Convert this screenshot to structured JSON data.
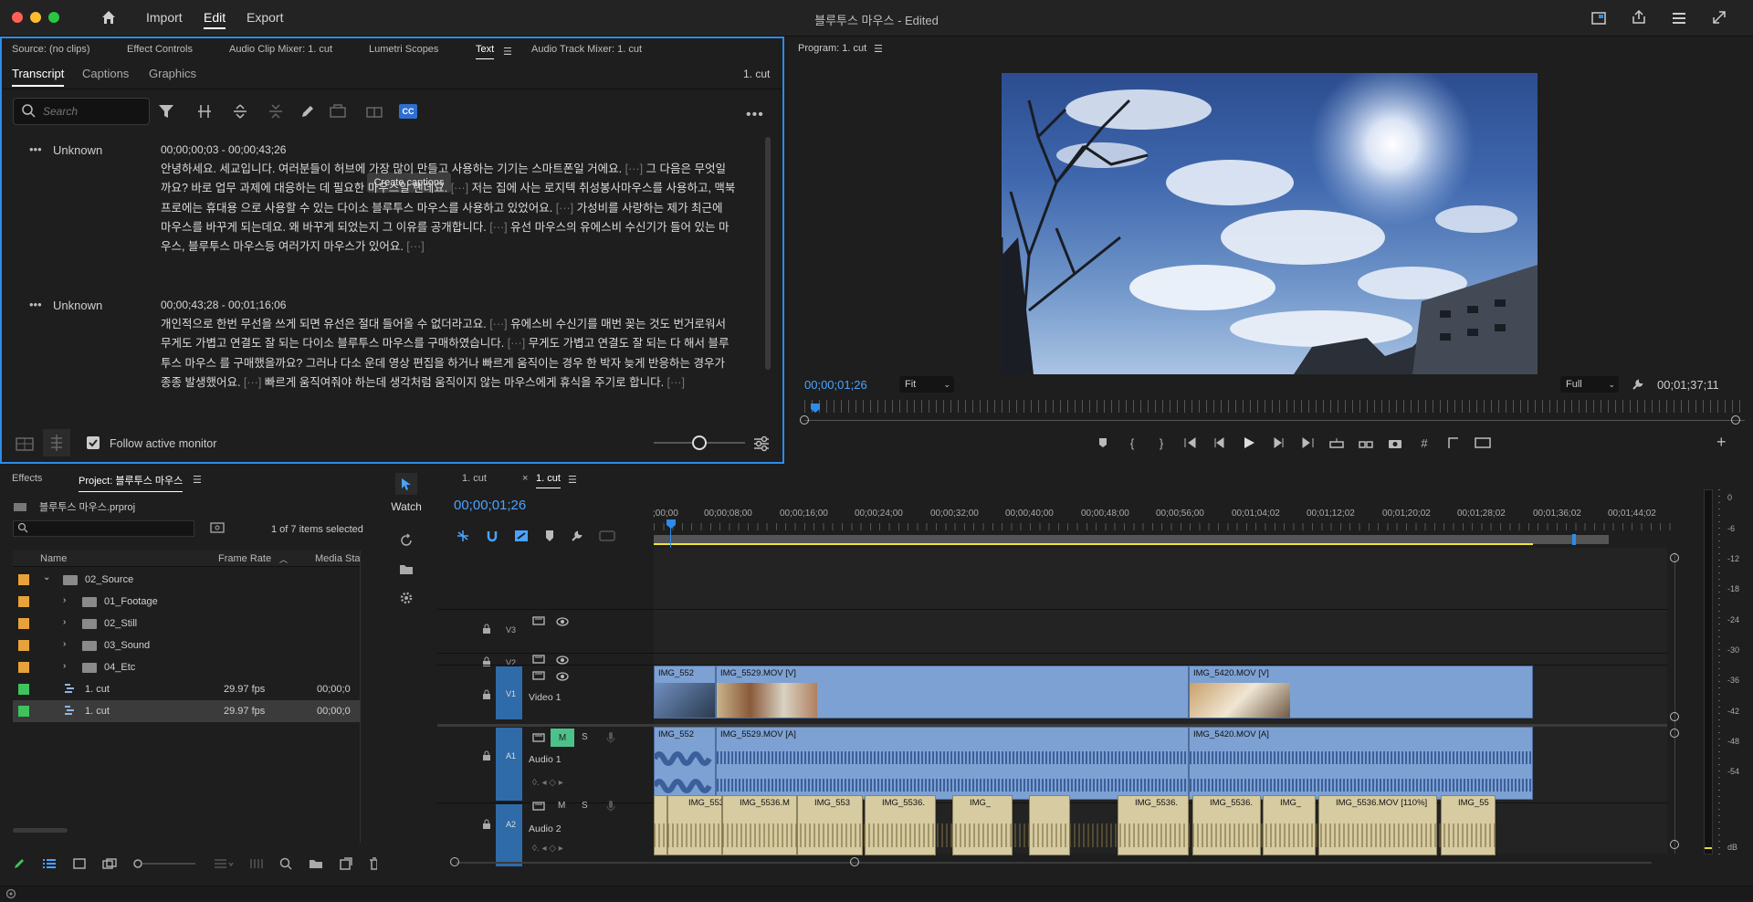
{
  "titlebar": {
    "menu": [
      "Import",
      "Edit",
      "Export"
    ],
    "active_menu": "Edit",
    "doc_title": "블루투스 마우스",
    "doc_status": " - Edited"
  },
  "source_panel": {
    "tabs": [
      "Source: (no clips)",
      "Effect Controls",
      "Audio Clip Mixer: 1. cut",
      "Lumetri Scopes",
      "Text",
      "Audio Track Mixer: 1. cut"
    ],
    "active_tab": "Text",
    "subtabs": [
      "Transcript",
      "Captions",
      "Graphics"
    ],
    "active_subtab": "Transcript",
    "sequence_name": "1. cut",
    "search_placeholder": "Search",
    "tooltip": "Create captions",
    "follow_label": "Follow active monitor",
    "blocks": [
      {
        "speaker": "Unknown",
        "timecode": "00;00;00;03 - 00;00;43;26",
        "lines": [
          "안녕하세요. 세교입니다. 여러분들이 허브에 가장 많이 만들고 사용하는 기기는 스마트폰일 거에요. [···] 그 다음은 무엇일",
          "까요? 바로 업무 과제에 대응하는 데 필요한 마우스일 텐데요. [···] 저는 집에 사는 로지텍 취성봉사마우스를 사용하고, 맥북",
          "프로에는 휴대용 으로 사용할 수 있는 다이소 블루투스 마우스를 사용하고 있었어요. [···] 가성비를 사랑하는 제가 최근에",
          "마우스를 바꾸게 되는데요. 왜 바꾸게 되었는지 그 이유를 공개합니다. [···] 유선 마우스의 유에스비 수신기가 들어 있는 마",
          "우스, 블루투스 마우스등 여러가지 마우스가 있어요. [···]"
        ]
      },
      {
        "speaker": "Unknown",
        "timecode": "00;00;43;28 - 00;01;16;06",
        "lines": [
          "개인적으로 한번 무선을 쓰게 되면 유선은 절대 들어올 수 없더라고요. [···] 유에스비 수신기를 매번 꽂는 것도 번거로워서",
          "무게도 가볍고 연결도 잘 되는 다이소 블루투스 마우스를 구매하였습니다. [···] 무게도 가볍고 연결도 잘 되는 다 해서 블루",
          "투스 마우스 를 구매했을까요? 그러나 다소 운데 영상 편집을 하거나 빠르게 움직이는 경우 한 박자 늦게 반응하는 경우가",
          "종종 발생했어요. [···] 빠르게 움직여줘야 하는데 생각처럼 움직이지 않는 마우스에게 휴식을 주기로 합니다. [···]"
        ]
      }
    ]
  },
  "program_monitor": {
    "title": "Program: 1. cut",
    "timecode": "00;00;01;26",
    "fit": "Fit",
    "quality": "Full",
    "duration": "00;01;37;11"
  },
  "project_panel": {
    "tabs": [
      "Effects",
      "Project: 블루투스 마우스"
    ],
    "active_tab": "Project: 블루투스 마우스",
    "file": "블루투스 마우스.prproj",
    "selected_info": "1 of 7 items selected",
    "columns": [
      "Name",
      "Frame Rate",
      "Media Sta"
    ],
    "rows": [
      {
        "name": "02_Source",
        "fps": "",
        "media": "",
        "type": "folder",
        "color": "#e8a23a",
        "indent": 0,
        "open": true
      },
      {
        "name": "01_Footage",
        "fps": "",
        "media": "",
        "type": "folder",
        "color": "#e8a23a",
        "indent": 1,
        "open": false
      },
      {
        "name": "02_Still",
        "fps": "",
        "media": "",
        "type": "folder",
        "color": "#e8a23a",
        "indent": 1,
        "open": false
      },
      {
        "name": "03_Sound",
        "fps": "",
        "media": "",
        "type": "folder",
        "color": "#e8a23a",
        "indent": 1,
        "open": false
      },
      {
        "name": "04_Etc",
        "fps": "",
        "media": "",
        "type": "folder",
        "color": "#e8a23a",
        "indent": 1,
        "open": false
      },
      {
        "name": "1. cut",
        "fps": "29.97 fps",
        "media": "00;00;0",
        "type": "sequence",
        "color": "#3fc35d",
        "indent": 0
      },
      {
        "name": "1. cut",
        "fps": "29.97 fps",
        "media": "00;00;0",
        "type": "sequence",
        "color": "#3fc35d",
        "indent": 0,
        "selected": true
      }
    ]
  },
  "tools_panel": {
    "watch_label": "Watch"
  },
  "timeline": {
    "tabs": [
      "1. cut",
      "1. cut"
    ],
    "active_tab": "1. cut",
    "timecode": "00;00;01;26",
    "ruler": [
      ";00;00",
      "00;00;08;00",
      "00;00;16;00",
      "00;00;24;00",
      "00;00;32;00",
      "00;00;40;00",
      "00;00;48;00",
      "00;00;56;00",
      "00;01;04;02",
      "00;01;12;02",
      "00;01;20;02",
      "00;01;28;02",
      "00;01;36;02",
      "00;01;44;02"
    ],
    "tracks": {
      "v3": "V3",
      "v2": "V2",
      "v1": "V1",
      "video1": "Video 1",
      "a1": "A1",
      "audio1": "Audio 1",
      "a2": "A2",
      "audio2": "Audio 2",
      "m": "M",
      "s": "S"
    },
    "v1_clips": [
      "IMG_552",
      "IMG_5529.MOV [V]",
      "IMG_5420.MOV [V]"
    ],
    "a1_clips": [
      "IMG_552",
      "IMG_5529.MOV [A]",
      "IMG_5420.MOV [A]"
    ],
    "a2_clips": [
      "IMG_553",
      "IMG_5536.M",
      "IMG_553",
      "IMG_5536.",
      "IMG_",
      "IMG_5536.",
      "IMG_5536.",
      "IMG_",
      "IMG_5536.MOV [110%]",
      "IMG_55"
    ]
  },
  "meter": {
    "scale": [
      "0",
      "-6",
      "-12",
      "-18",
      "-24",
      "-30",
      "-36",
      "-42",
      "-48",
      "-54"
    ],
    "unit": "dB"
  },
  "colors": {
    "accent": "#2d8ceb",
    "video_clip": "#7da1d2",
    "audio_clip2": "#d6cba1",
    "label_orange": "#e8a23a",
    "label_green": "#3fc35d"
  }
}
